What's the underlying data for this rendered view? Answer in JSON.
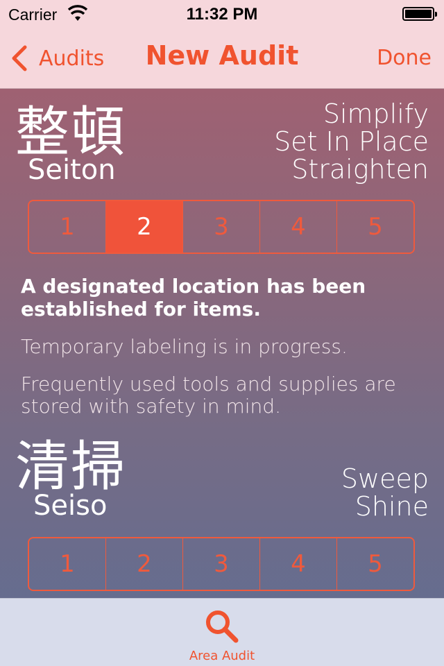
{
  "status_bar": {
    "carrier": "Carrier",
    "time": "11:32 PM"
  },
  "nav": {
    "back_label": "Audits",
    "title": "New Audit",
    "done_label": "Done"
  },
  "sections": [
    {
      "kanji": "整頓",
      "romaji": "Seiton",
      "english": [
        "Simplify",
        "Set In Place",
        "Straighten"
      ],
      "ratings": [
        "1",
        "2",
        "3",
        "4",
        "5"
      ],
      "selected_rating": "2",
      "description": {
        "headline": "A designated location has been established for items.",
        "lines": [
          "Temporary labeling is in progress.",
          "Frequently used tools and supplies are stored with safety in mind."
        ]
      }
    },
    {
      "kanji": "清掃",
      "romaji": "Seiso",
      "english": [
        "Sweep",
        "Shine"
      ],
      "ratings": [
        "1",
        "2",
        "3",
        "4",
        "5"
      ],
      "selected_rating": null
    }
  ],
  "tab_bar": {
    "tabs": [
      {
        "label": "Area Audit",
        "icon": "search-icon",
        "active": true
      }
    ]
  },
  "colors": {
    "accent": "#f0532f",
    "nav_background": "#f6d7dc",
    "tab_background": "#d8dceb"
  }
}
